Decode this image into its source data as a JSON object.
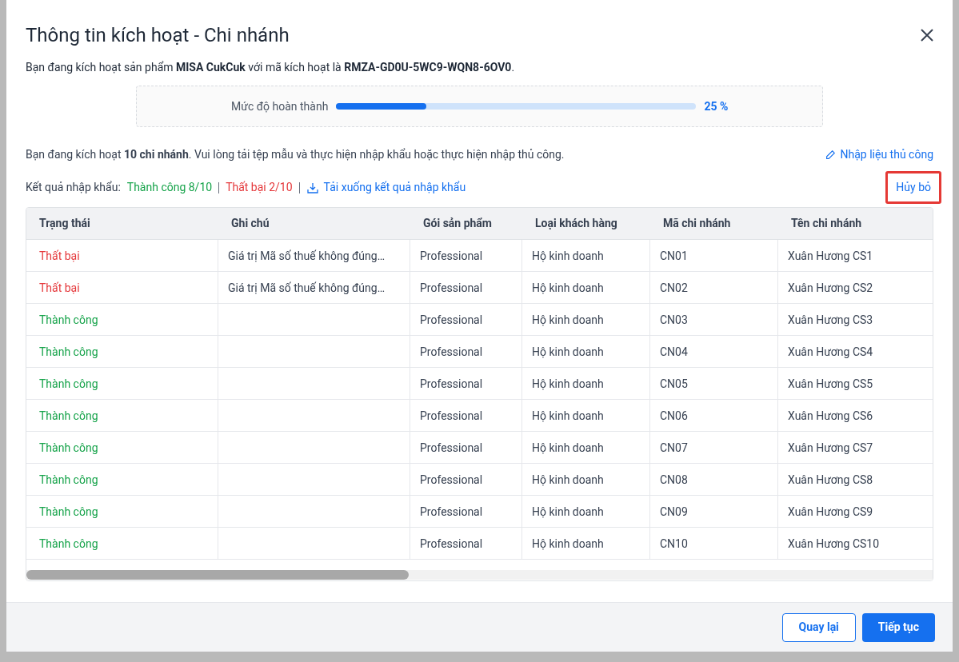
{
  "dialog": {
    "title": "Thông tin kích hoạt - Chi nhánh"
  },
  "intro": "Bạn đang kích hoạt sản phẩm **MISA CukCuk** với mã kích hoạt là **RMZA-GD0U-5WC9-WQN8-6OV0**.",
  "progress": {
    "label": "Mức độ hoàn thành",
    "level": 0.25,
    "reading": "25 %"
  },
  "instruction": "Bạn đang kích hoạt **10 chi nhánh**. Vui lòng tải tệp mẫu và thực hiện nhập khẩu hoặc thực hiện nhập thủ công.",
  "manual_entry_link": "Nhập liệu thủ công",
  "import_result": {
    "label": "Kết quả nhập khẩu:",
    "success": "Thành công 8/10",
    "failed": "Thất bại 2/10",
    "download_link": "Tải xuống kết quả nhập khẩu"
  },
  "cancel_link": {
    "label": "Hủy bỏ",
    "highlighted": true
  },
  "table": {
    "columns": [
      "Trạng thái",
      "Ghi chú",
      "Gói sản phẩm",
      "Loại khách hàng",
      "Mã chi nhánh",
      "Tên chi nhánh"
    ],
    "rows": [
      {
        "status": {
          "kind": "failed",
          "text": "Thất bại"
        },
        "note": "Giá trị Mã số thuế không đúng…",
        "package": "Professional",
        "customer_type": "Hộ kinh doanh",
        "branch_code": "CN01",
        "branch_name": "Xuân Hương CS1"
      },
      {
        "status": {
          "kind": "failed",
          "text": "Thất bại"
        },
        "note": "Giá trị Mã số thuế không đúng…",
        "package": "Professional",
        "customer_type": "Hộ kinh doanh",
        "branch_code": "CN02",
        "branch_name": "Xuân Hương CS2"
      },
      {
        "status": {
          "kind": "success",
          "text": "Thành công"
        },
        "package": "Professional",
        "customer_type": "Hộ kinh doanh",
        "branch_code": "CN03",
        "branch_name": "Xuân Hương CS3"
      },
      {
        "status": {
          "kind": "success",
          "text": "Thành công"
        },
        "package": "Professional",
        "customer_type": "Hộ kinh doanh",
        "branch_code": "CN04",
        "branch_name": "Xuân Hương CS4"
      },
      {
        "status": {
          "kind": "success",
          "text": "Thành công"
        },
        "package": "Professional",
        "customer_type": "Hộ kinh doanh",
        "branch_code": "CN05",
        "branch_name": "Xuân Hương CS5"
      },
      {
        "status": {
          "kind": "success",
          "text": "Thành công"
        },
        "package": "Professional",
        "customer_type": "Hộ kinh doanh",
        "branch_code": "CN06",
        "branch_name": "Xuân Hương CS6"
      },
      {
        "status": {
          "kind": "success",
          "text": "Thành công"
        },
        "package": "Professional",
        "customer_type": "Hộ kinh doanh",
        "branch_code": "CN07",
        "branch_name": "Xuân Hương CS7"
      },
      {
        "status": {
          "kind": "success",
          "text": "Thành công"
        },
        "package": "Professional",
        "customer_type": "Hộ kinh doanh",
        "branch_code": "CN08",
        "branch_name": "Xuân Hương CS8"
      },
      {
        "status": {
          "kind": "success",
          "text": "Thành công"
        },
        "package": "Professional",
        "customer_type": "Hộ kinh doanh",
        "branch_code": "CN09",
        "branch_name": "Xuân Hương CS9"
      },
      {
        "status": {
          "kind": "success",
          "text": "Thành công"
        },
        "package": "Professional",
        "customer_type": "Hộ kinh doanh",
        "branch_code": "CN10",
        "branch_name": "Xuân Hương CS10"
      }
    ]
  },
  "buttons": {
    "back": "Quay lại",
    "next": "Tiếp tục"
  }
}
